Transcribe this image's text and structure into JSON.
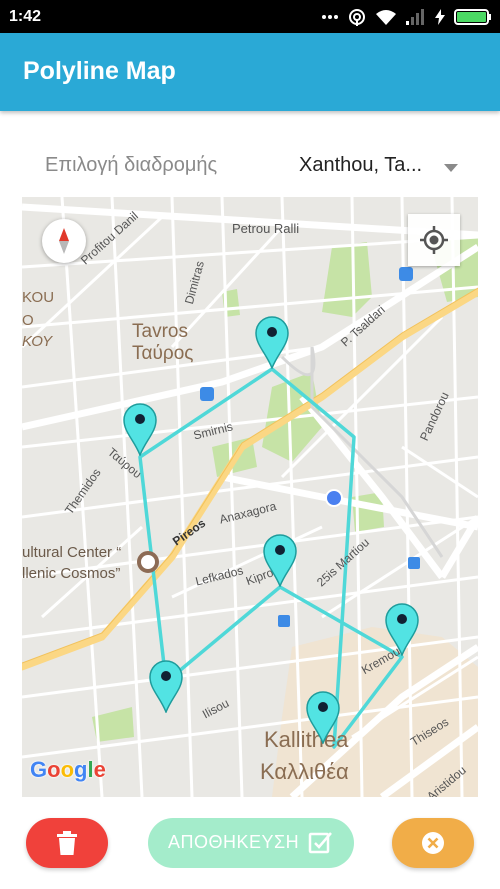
{
  "status_bar": {
    "time": "1:42",
    "icons": [
      "more-dots-icon",
      "hotspot-icon",
      "wifi-icon",
      "signal-icon",
      "charging-icon",
      "battery-icon"
    ]
  },
  "app_bar": {
    "title": "Polyline Map"
  },
  "route_selector": {
    "label": "Επιλογή διαδρομής",
    "selected": "Xanthou, Ta..."
  },
  "map": {
    "labels": {
      "petrou_ralli": "Petrou Ralli",
      "profitou_danil": "Profitou Danil",
      "dimitras": "Dimitras",
      "p_tsaldari": "P. Tsaldari",
      "tavros_latin": "Tavros",
      "tavros_greek": "Ταύρος",
      "smirnis": "Smirnis",
      "pandorou": "Pandorou",
      "tavrou": "Ταύρου",
      "themidos": "Themidos",
      "pireos": "Pireos",
      "anaxagora": "Anaxagora",
      "martiou": "25is Martiou",
      "cultural_center_1": "ultural Center “",
      "cultural_center_2": "llenic Cosmos”",
      "lefkados": "Lefkados",
      "kiprou": "Kiprou",
      "kremou": "Kremou",
      "ilisou": "Ilisou",
      "thiseos": "Thiseos",
      "kallithea_latin": "Kallithea",
      "kallithea_greek": "Καλλιθέα",
      "aristidou": "Aristidou",
      "left_edge_1": "ΚΟU",
      "left_edge_2": "O",
      "left_edge_3": "ΚΟΥ"
    },
    "google_logo": [
      "G",
      "o",
      "o",
      "g",
      "l",
      "e"
    ],
    "google_colors": [
      "#4285F4",
      "#EA4335",
      "#FBBC05",
      "#4285F4",
      "#34A853",
      "#EA4335"
    ],
    "marker_count": 6,
    "route_color": "#4fd8d8",
    "marker_color": "#52e3e3"
  },
  "actions": {
    "save_label": "ΑΠΟΘΗΚΕΥΣΗ",
    "delete_icon": "trash-icon",
    "cancel_icon": "close-circle-icon",
    "colors": {
      "delete": "#f0413b",
      "save": "#a4eccb",
      "cancel": "#f1ad48"
    }
  }
}
